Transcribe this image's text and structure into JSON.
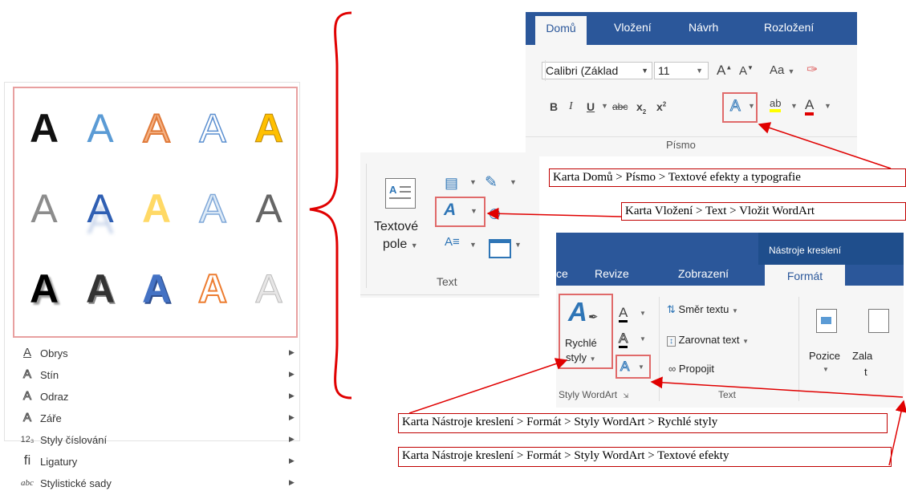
{
  "gallery": {
    "rows": [
      [
        {
          "ch": "A",
          "style": "black"
        },
        {
          "ch": "A",
          "style": "blue-grad"
        },
        {
          "ch": "A",
          "style": "orange-outline"
        },
        {
          "ch": "A",
          "style": "blue-outline"
        },
        {
          "ch": "A",
          "style": "gold"
        }
      ],
      [
        {
          "ch": "A",
          "style": "gray"
        },
        {
          "ch": "A",
          "style": "blue-reflect"
        },
        {
          "ch": "A",
          "style": "yellow"
        },
        {
          "ch": "A",
          "style": "light-blue-outline"
        },
        {
          "ch": "A",
          "style": "dark-gray"
        }
      ],
      [
        {
          "ch": "A",
          "style": "black-shadow"
        },
        {
          "ch": "A",
          "style": "dark-3d"
        },
        {
          "ch": "A",
          "style": "blue-3d"
        },
        {
          "ch": "A",
          "style": "orange-white"
        },
        {
          "ch": "A",
          "style": "light-gray"
        }
      ]
    ],
    "menu": [
      {
        "icon": "A",
        "label": "Obrys",
        "name": "obrys"
      },
      {
        "icon": "A",
        "label": "Stín",
        "name": "stin"
      },
      {
        "icon": "A",
        "label": "Odraz",
        "name": "odraz"
      },
      {
        "icon": "A",
        "label": "Záře",
        "name": "zare"
      },
      {
        "icon": "12₃",
        "label": "Styly číslování",
        "name": "styly-cislovani"
      },
      {
        "icon": "fi",
        "label": "Ligatury",
        "name": "ligatury"
      },
      {
        "icon": "abc",
        "label": "Stylistické sady",
        "name": "stylisticke-sady"
      }
    ]
  },
  "ribbon1": {
    "tabs": [
      "Domů",
      "Vložení",
      "Návrh",
      "Rozložení"
    ],
    "font_name": "Calibri (Základ",
    "font_size": "11",
    "aa_label": "Aa",
    "group_label": "Písmo"
  },
  "ribbon2": {
    "textbox_label_1": "Textové",
    "textbox_label_2": "pole",
    "group_label": "Text"
  },
  "ribbon3": {
    "context_title": "Nástroje kreslení",
    "tabs": [
      "ce",
      "Revize",
      "Zobrazení",
      "Formát"
    ],
    "quick_styles_1": "Rychlé",
    "quick_styles_2": "styly",
    "text_direction": "Směr textu",
    "align_text": "Zarovnat text",
    "link": "Propojit",
    "position": "Pozice",
    "wrap_1": "Zala",
    "wrap_2": "t",
    "group_wordart": "Styly WordArt",
    "group_text": "Text"
  },
  "callouts": {
    "c1": "Karta Domů > Písmo > Textové efekty a typografie",
    "c2": "Karta Vložení > Text > Vložit WordArt",
    "c3": "Karta Nástroje kreslení > Formát > Styly WordArt > Rychlé styly",
    "c4": "Karta Nástroje kreslení > Formát > Styly WordArt > Textové efekty"
  },
  "colors": {
    "ribbon_blue": "#2b579a",
    "highlight_red": "#e06a6a",
    "arrow_red": "#e00000"
  }
}
